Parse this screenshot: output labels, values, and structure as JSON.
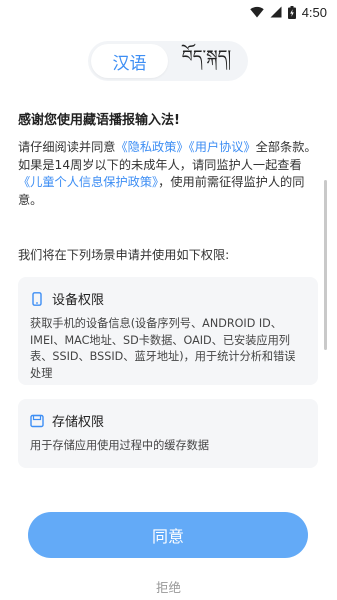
{
  "status_bar": {
    "time": "4:50",
    "icons": [
      "wifi-icon",
      "cell-signal-icon",
      "battery-charging-icon"
    ]
  },
  "language_toggle": {
    "options": [
      {
        "label": "汉语",
        "selected": true
      },
      {
        "label": "བོད་སྐད།",
        "selected": false
      }
    ],
    "active_color": "#3d8ef4"
  },
  "dialog": {
    "title": "感谢您使用藏语播报输入法!",
    "intro": {
      "p1": "请仔细阅读并同意",
      "privacy_link": "《隐私政策》",
      "agreement_link": "《用户协议》",
      "p2": "全部条款。如果是14周岁以下的未成年人，请同监护人一起查看",
      "child_link": "《儿童个人信息保护政策》",
      "p3": "，使用前需征得监护人的同意。"
    },
    "permissions_heading": "我们将在下列场景申请并使用如下权限:",
    "permissions": [
      {
        "icon": "phone-icon",
        "title": "设备权限",
        "description": "获取手机的设备信息(设备序列号、ANDROID ID、IMEI、MAC地址、SD卡数据、OAID、已安装应用列表、SSID、BSSID、蓝牙地址)，用于统计分析和错误处理"
      },
      {
        "icon": "storage-icon",
        "title": "存储权限",
        "description": "用于存储应用使用过程中的缓存数据"
      }
    ],
    "agree_label": "同意",
    "refuse_label": "拒绝"
  },
  "colors": {
    "accent": "#3d8ef4",
    "button": "#63aaf7",
    "card_bg": "#f5f6f8"
  }
}
